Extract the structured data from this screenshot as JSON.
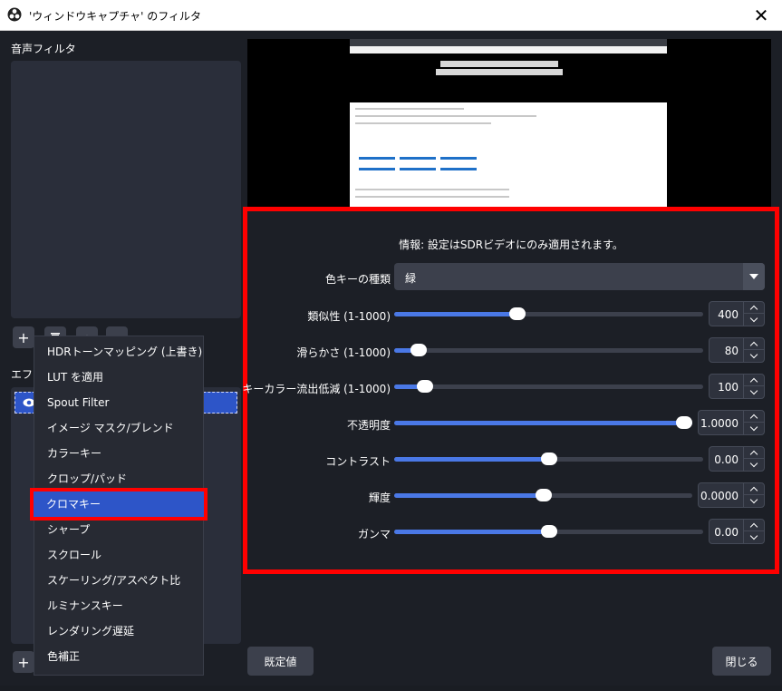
{
  "window": {
    "title": "'ウィンドウキャプチャ' のフィルタ",
    "app_icon": "obs-icon",
    "close_icon": "close-icon",
    "close_glyph": "✕"
  },
  "audio_filters": {
    "label": "音声フィルタ",
    "add_glyph": "+",
    "remove_icon": "trash-icon"
  },
  "effect_filters": {
    "label": "エフェ",
    "add_glyph": "+"
  },
  "settings": {
    "info": "情報: 設定はSDRビデオにのみ適用されます。",
    "key_type_label": "色キーの種類",
    "key_type_value": "緑",
    "sliders": [
      {
        "label": "類似性 (1-1000)",
        "value": "400",
        "fraction": 0.4
      },
      {
        "label": "滑らかさ (1-1000)",
        "value": "80",
        "fraction": 0.08
      },
      {
        "label": "キーカラー流出低減 (1-1000)",
        "value": "100",
        "fraction": 0.1
      },
      {
        "label": "不透明度",
        "value": "1.0000",
        "fraction": 1.0
      },
      {
        "label": "コントラスト",
        "value": "0.00",
        "fraction": 0.5
      },
      {
        "label": "輝度",
        "value": "0.0000",
        "fraction": 0.5
      },
      {
        "label": "ガンマ",
        "value": "0.00",
        "fraction": 0.5
      }
    ]
  },
  "menu": {
    "items": [
      "HDRトーンマッピング (上書き)",
      "LUT を適用",
      "Spout Filter",
      "イメージ マスク/ブレンド",
      "カラーキー",
      "クロップ/パッド",
      "クロマキー",
      "シャープ",
      "スクロール",
      "スケーリング/アスペクト比",
      "ルミナンスキー",
      "レンダリング遅延",
      "色補正"
    ],
    "selected_index": 6
  },
  "buttons": {
    "defaults": "既定値",
    "close": "閉じる"
  },
  "colors": {
    "accent": "#4a78e6",
    "highlight_border": "#ff0000",
    "selected_item": "#2d55c8",
    "background": "#1c1f26"
  }
}
